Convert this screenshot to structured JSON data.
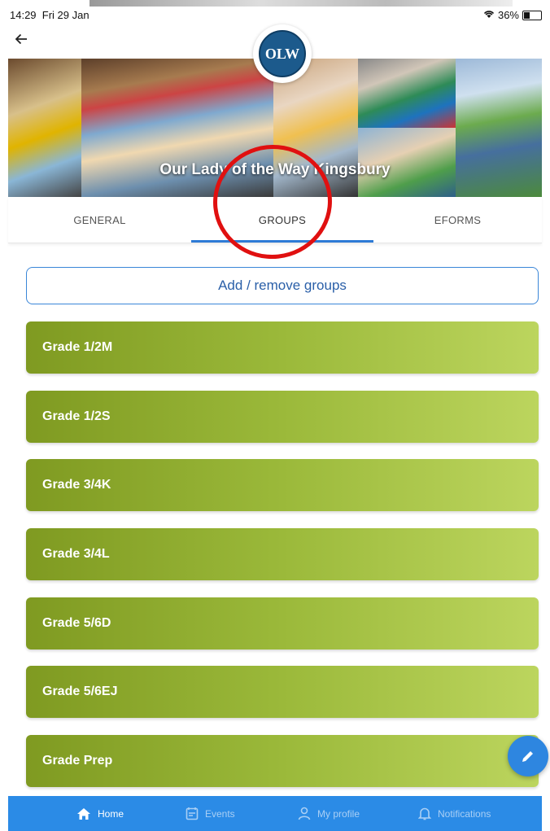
{
  "status_bar": {
    "time": "14:29",
    "date": "Fri 29 Jan",
    "battery": "36%"
  },
  "school": {
    "name": "Our Lady of the Way Kingsbury",
    "logo_text": "OLW"
  },
  "tabs": [
    {
      "label": "GENERAL",
      "active": false
    },
    {
      "label": "GROUPS",
      "active": true
    },
    {
      "label": "EFORMS",
      "active": false
    }
  ],
  "add_remove_label": "Add / remove groups",
  "groups": [
    {
      "label": "Grade 1/2M"
    },
    {
      "label": "Grade 1/2S"
    },
    {
      "label": "Grade 3/4K"
    },
    {
      "label": "Grade 3/4L"
    },
    {
      "label": "Grade 5/6D"
    },
    {
      "label": "Grade 5/6EJ"
    },
    {
      "label": "Grade Prep"
    }
  ],
  "bottom_nav": [
    {
      "label": "Home",
      "icon": "home-icon",
      "active": true
    },
    {
      "label": "Events",
      "icon": "calendar-icon",
      "active": false
    },
    {
      "label": "My profile",
      "icon": "person-icon",
      "active": false
    },
    {
      "label": "Notifications",
      "icon": "bell-icon",
      "active": false
    }
  ],
  "colors": {
    "accent": "#2b8be6",
    "group_gradient_start": "#7f9a21",
    "group_gradient_end": "#bcd55e",
    "annotation": "#e01010"
  }
}
